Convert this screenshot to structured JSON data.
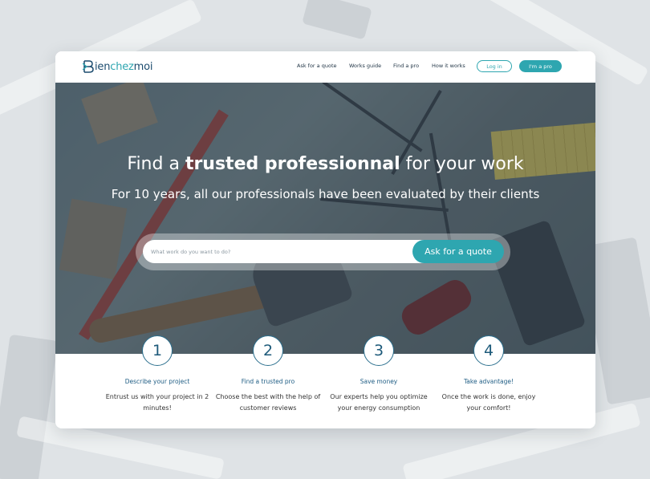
{
  "brand": {
    "name_part1": "ien",
    "name_part2": "chez",
    "name_part3": "moi",
    "colors": {
      "primary": "#1b4b6e",
      "accent": "#2ea6b0"
    }
  },
  "nav": {
    "items": [
      "Ask for a quote",
      "Works guide",
      "Find a pro",
      "How it works"
    ],
    "login": "Log in",
    "pro": "I'm a pro"
  },
  "hero": {
    "title_pre": "Find a ",
    "title_bold": "trusted professionnal",
    "title_post": " for your work",
    "subtitle": "For 10 years, all our professionals have been evaluated by their clients",
    "search_placeholder": "What work do you want to do?",
    "search_button": "Ask for a quote"
  },
  "steps": [
    {
      "number": "1",
      "title": "Describe your project",
      "desc": "Entrust us with your project in 2 minutes!"
    },
    {
      "number": "2",
      "title": "Find a trusted pro",
      "desc": "Choose the best with the help of customer reviews"
    },
    {
      "number": "3",
      "title": "Save money",
      "desc": "Our experts help you optimize your energy consumption"
    },
    {
      "number": "4",
      "title": "Take advantage!",
      "desc": "Once the work is done, enjoy your comfort!"
    }
  ]
}
